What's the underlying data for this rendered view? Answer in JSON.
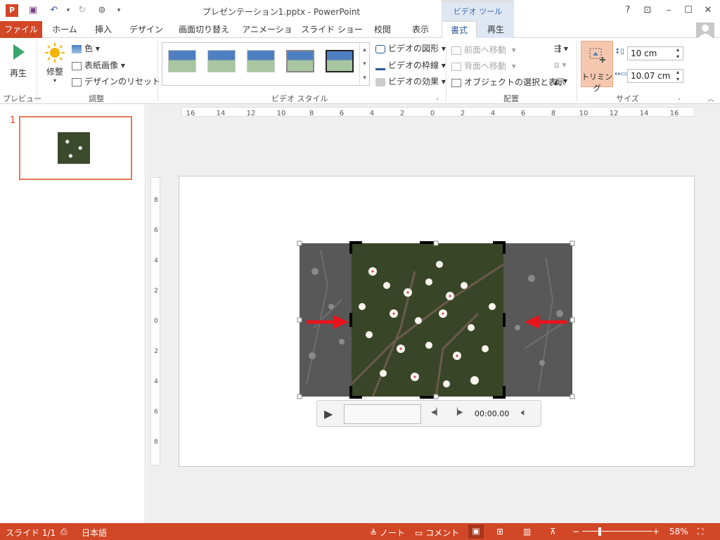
{
  "titlebar": {
    "title": "プレゼンテーション1.pptx - PowerPoint",
    "context_tab": "ビデオ ツール",
    "help": "?"
  },
  "tabs": {
    "file": "ファイル",
    "home": "ホーム",
    "insert": "挿入",
    "design": "デザイン",
    "transitions": "画面切り替え",
    "animations": "アニメーション",
    "slideshow": "スライド ショー",
    "review": "校閲",
    "view": "表示",
    "format": "書式",
    "playback": "再生"
  },
  "ribbon": {
    "preview": {
      "play": "再生",
      "group": "プレビュー"
    },
    "adjust": {
      "corrections": "修整",
      "color": "色",
      "poster_frame": "表紙画像",
      "reset_design": "デザインのリセット",
      "group": "調整"
    },
    "video_styles": {
      "shape": "ビデオの図形",
      "border": "ビデオの枠線",
      "effects": "ビデオの効果",
      "group": "ビデオ スタイル"
    },
    "arrange": {
      "bring_forward": "前面へ移動",
      "send_backward": "背面へ移動",
      "selection_pane": "オブジェクトの選択と表示",
      "group": "配置"
    },
    "size": {
      "crop": "トリミング",
      "height": "10 cm",
      "width": "10.07 cm",
      "group": "サイズ"
    }
  },
  "thumbnail": {
    "number": "1"
  },
  "ruler": {
    "h_ticks": [
      "16",
      "14",
      "12",
      "10",
      "8",
      "6",
      "4",
      "2",
      "0",
      "2",
      "4",
      "6",
      "8",
      "10",
      "12",
      "14",
      "16"
    ],
    "v_ticks": [
      "8",
      "6",
      "4",
      "2",
      "0",
      "2",
      "4",
      "6",
      "8"
    ]
  },
  "player": {
    "time": "00:00.00"
  },
  "statusbar": {
    "slide": "スライド 1/1",
    "language": "日本語",
    "notes": "ノート",
    "comments": "コメント",
    "zoom": "58%"
  },
  "colors": {
    "accent": "#d24726",
    "context": "#dfe7f3",
    "crop_active": "#f5c7ae",
    "arrow": "#e8141c"
  }
}
